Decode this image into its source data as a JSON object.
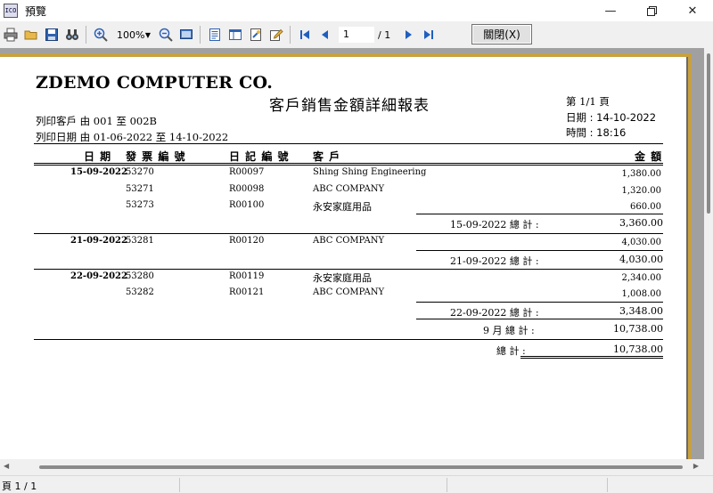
{
  "window": {
    "title": "預覽",
    "app_icon_text": "ICO"
  },
  "toolbar": {
    "zoom_value": "100%",
    "page_current": "1",
    "page_total": "/ 1",
    "close_label": "關閉(X)"
  },
  "report": {
    "company": "ZDEMO COMPUTER CO.",
    "title": "客戶銷售金額詳細報表",
    "page_info": "第 1/1 頁",
    "print_date": "日期 : 14-10-2022",
    "print_time": "時間 : 18:16",
    "filter_customer": "列印客戶  由  001  至   002B",
    "filter_date": "列印日期 由   01-06-2022  至 14-10-2022",
    "columns": {
      "date": "日 期",
      "invoice": "發 票 編 號",
      "journal": "日 記 編 號",
      "customer": "客 戶",
      "amount": "金 額"
    },
    "groups": [
      {
        "date": "15-09-2022",
        "rows": [
          {
            "invoice": "53270",
            "journal": "R00097",
            "customer": "Shing Shing Engineering",
            "amount": "1,380.00"
          },
          {
            "invoice": "53271",
            "journal": "R00098",
            "customer": "ABC COMPANY",
            "amount": "1,320.00"
          },
          {
            "invoice": "53273",
            "journal": "R00100",
            "customer": "永安家庭用品",
            "amount": "660.00"
          }
        ],
        "subtotal_label": "15-09-2022  總 計 :",
        "subtotal": "3,360.00"
      },
      {
        "date": "21-09-2022",
        "rows": [
          {
            "invoice": "53281",
            "journal": "R00120",
            "customer": "ABC COMPANY",
            "amount": "4,030.00"
          }
        ],
        "subtotal_label": "21-09-2022  總 計 :",
        "subtotal": "4,030.00"
      },
      {
        "date": "22-09-2022",
        "rows": [
          {
            "invoice": "53280",
            "journal": "R00119",
            "customer": "永安家庭用品",
            "amount": "2,340.00"
          },
          {
            "invoice": "53282",
            "journal": "R00121",
            "customer": "ABC COMPANY",
            "amount": "1,008.00"
          }
        ],
        "subtotal_label": "22-09-2022  總 計 :",
        "subtotal": "3,348.00"
      }
    ],
    "month_total_label": "9 月 總 計 :",
    "month_total": "10,738.00",
    "grand_total_label": "總  計 :",
    "grand_total": "10,738.00"
  },
  "status": {
    "page_text": "頁 1 / 1"
  },
  "colors": {
    "page_border": "#c8a040",
    "viewer_bg": "#a0a0a0",
    "icon_blue": "#1f5fbf"
  }
}
